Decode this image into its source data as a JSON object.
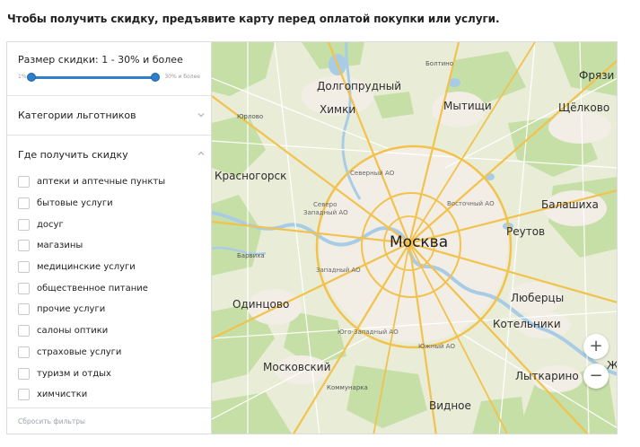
{
  "headline": "Чтобы получить скидку, предъявите карту перед оплатой покупки или услуги.",
  "filters": {
    "discount_size": {
      "title": "Размер скидки: 1 - 30% и более",
      "min_label": "1%",
      "max_label": "30% и более",
      "min_value": 1,
      "max_value": 30
    },
    "categories_heading": "Категории льготников",
    "where_heading": "Где получить скидку",
    "where_options": [
      {
        "label": "аптеки и аптечные пункты",
        "checked": false
      },
      {
        "label": "бытовые услуги",
        "checked": false
      },
      {
        "label": "досуг",
        "checked": false
      },
      {
        "label": "магазины",
        "checked": false
      },
      {
        "label": "медицинские услуги",
        "checked": false
      },
      {
        "label": "общественное питание",
        "checked": false
      },
      {
        "label": "прочие услуги",
        "checked": false
      },
      {
        "label": "салоны оптики",
        "checked": false
      },
      {
        "label": "страховые услуги",
        "checked": false
      },
      {
        "label": "туризм и отдых",
        "checked": false
      },
      {
        "label": "химчистки",
        "checked": false
      }
    ],
    "reset_label": "Сбросить фильтры"
  },
  "map": {
    "center_label": "Москва",
    "labels": {
      "dolgoprudny": "Долгопрудный",
      "khimki": "Химки",
      "mytishchi": "Мытищи",
      "fryazino": "Фрязи",
      "shchelkovo": "Щёлково",
      "krasnogorsk": "Красногорск",
      "balashikha": "Балашиха",
      "reutov": "Реутов",
      "odintsovo": "Одинцово",
      "lyubertsy": "Люберцы",
      "kotelniki": "Котельники",
      "moskovsky": "Московский",
      "lytkarino": "Лыткарино",
      "vidnoe": "Видное",
      "boltino": "Болтино",
      "yurlovo": "Юрлово",
      "severny_ao": "Северный АО",
      "severo_zapadny": "Северо",
      "zapadny_ao1": "Западный АО",
      "vostochny_ao": "Восточный АО",
      "barvikha": "Барвиха",
      "zapadny_ao2": "Западный АО",
      "yugo_zapadny": "Юго-Западный АО",
      "yuzhny_ao": "Южный АО",
      "kommunarka": "Коммунарка",
      "edge_zh": "Ж"
    },
    "zoom_in": "+",
    "zoom_out": "−",
    "colors": {
      "land": "#e9edd8",
      "forest": "#c5dea5",
      "water": "#a9cce6",
      "urban": "#f1ede4",
      "major_road": "#f3c553",
      "minor_road": "#ffffff"
    }
  }
}
